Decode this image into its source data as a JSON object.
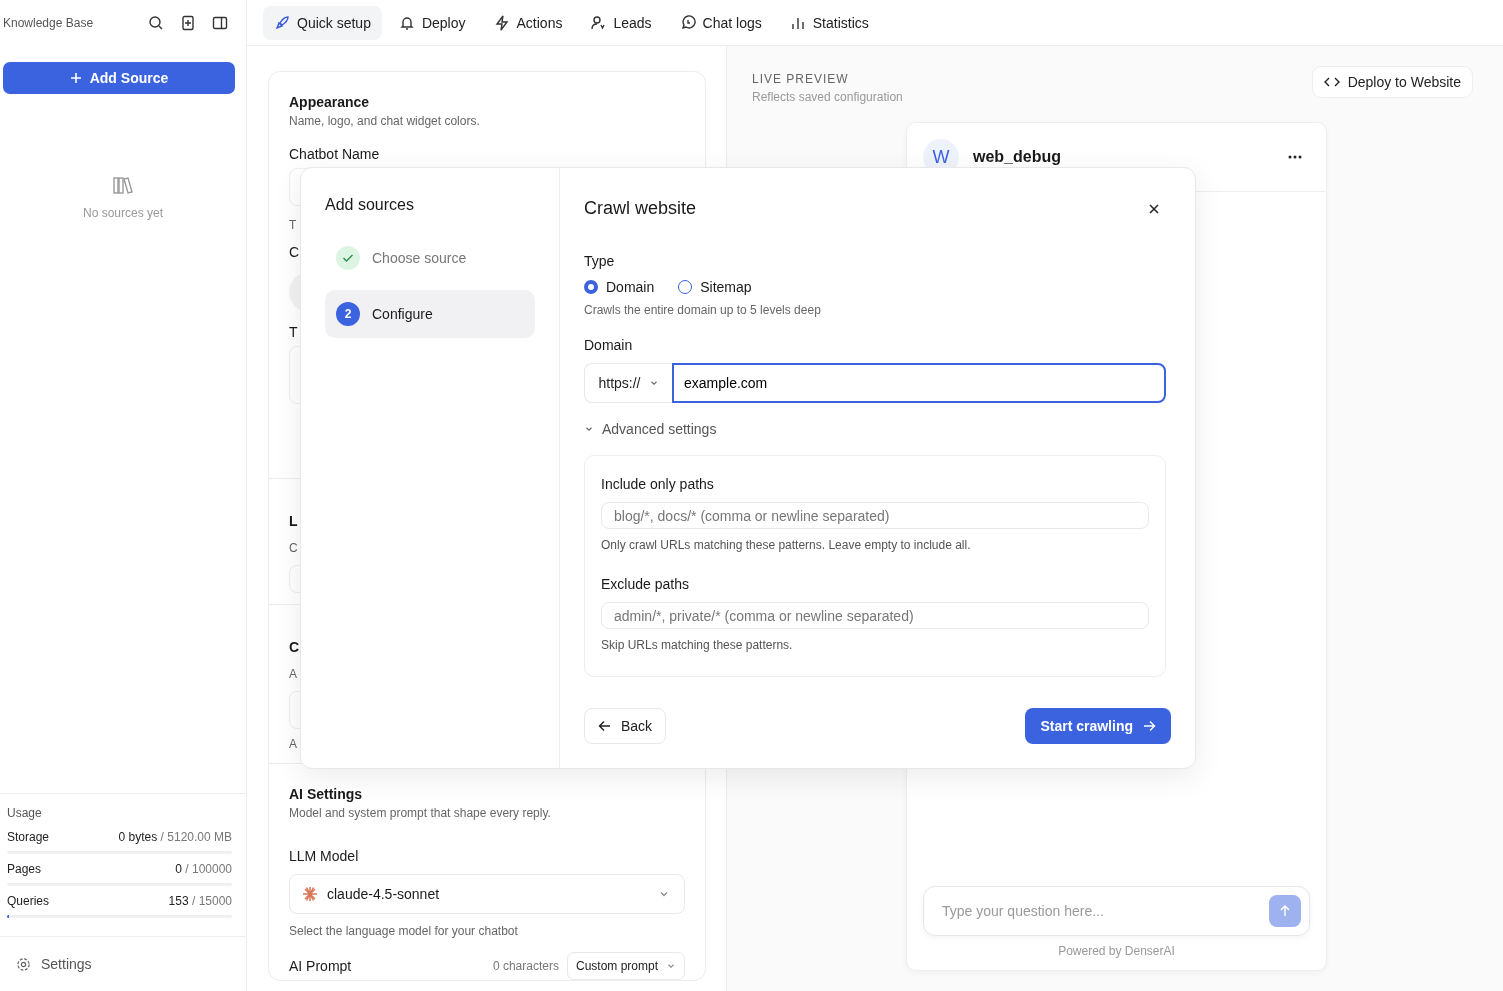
{
  "sidebar": {
    "title": "Knowledge Base",
    "add_button": "Add Source",
    "empty_text": "No sources yet",
    "usage": {
      "title": "Usage",
      "meters": [
        {
          "name": "Storage",
          "used": "0 bytes",
          "limit": "/ 5120.00 MB"
        },
        {
          "name": "Pages",
          "used": "0",
          "limit": "/ 100000"
        },
        {
          "name": "Queries",
          "used": "153",
          "limit": "/ 15000",
          "level": 0.0102
        }
      ]
    },
    "settings": "Settings"
  },
  "tabs": [
    {
      "label": "Quick setup",
      "selected": true
    },
    {
      "label": "Deploy",
      "selected": false
    },
    {
      "label": "Actions",
      "selected": false
    },
    {
      "label": "Leads",
      "selected": false
    },
    {
      "label": "Chat logs",
      "selected": false
    },
    {
      "label": "Statistics",
      "selected": false
    }
  ],
  "appearance": {
    "title": "Appearance",
    "subtitle": "Name, logo, and chat widget colors.",
    "name_label": "Chatbot Name"
  },
  "covered_texts": [
    "T",
    "C",
    "T",
    "L",
    "C",
    "C",
    "A",
    "A"
  ],
  "ai_settings": {
    "title": "AI Settings",
    "subtitle": "Model and system prompt that shape every reply.",
    "model_label": "LLM Model",
    "model": "claude-4.5-sonnet",
    "model_hint": "Select the language model for your chatbot",
    "prompt_label": "AI Prompt",
    "char_count": "0 characters",
    "prompt_mode": "Custom prompt"
  },
  "preview": {
    "title": "LIVE PREVIEW",
    "subtitle": "Reflects saved configuration",
    "deploy_button": "Deploy to Website",
    "chat": {
      "avatar": "W",
      "name": "web_debug",
      "input_placeholder": "Type your question here...",
      "footer": "Powered by DenserAI"
    }
  },
  "modal": {
    "sidebar_title": "Add sources",
    "steps": [
      {
        "label": "Choose source",
        "completed": true,
        "selected": false
      },
      {
        "number": "2",
        "label": "Configure",
        "completed": false,
        "selected": true
      }
    ],
    "title": "Crawl website",
    "type_label": "Type",
    "types": [
      {
        "label": "Domain",
        "selected": true
      },
      {
        "label": "Sitemap",
        "selected": false
      }
    ],
    "type_hint": "Crawls the entire domain up to 5 levels deep",
    "domain_label": "Domain",
    "protocol": "https://",
    "domain_value": "example.com",
    "advanced": {
      "label": "Advanced settings",
      "expanded": true,
      "fields": [
        {
          "label": "Include only paths",
          "placeholder": "blog/*, docs/* (comma or newline separated)",
          "hint": "Only crawl URLs matching these patterns. Leave empty to include all."
        },
        {
          "label": "Exclude paths",
          "placeholder": "admin/*, private/* (comma or newline separated)",
          "hint": "Skip URLs matching these patterns."
        }
      ]
    },
    "back_button": "Back",
    "start_button": "Start crawling"
  }
}
